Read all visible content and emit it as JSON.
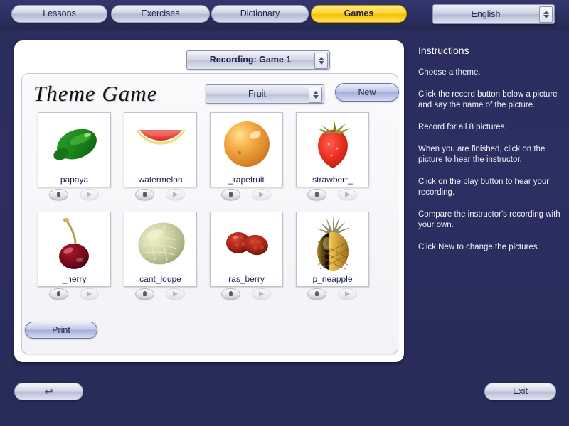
{
  "nav": {
    "tabs": [
      {
        "label": "Lessons",
        "active": false
      },
      {
        "label": "Exercises",
        "active": false
      },
      {
        "label": "Dictionary",
        "active": false
      },
      {
        "label": "Games",
        "active": true
      }
    ],
    "language": "English"
  },
  "panel": {
    "recording_select": "Recording: Game 1",
    "game_title": "Theme Game",
    "theme_select": "Fruit",
    "new_button": "New",
    "print_button": "Print"
  },
  "cards": [
    {
      "label": "papaya",
      "image": "papaya",
      "record_enabled": true,
      "play_enabled": false
    },
    {
      "label": "watermelon",
      "image": "watermelon",
      "record_enabled": true,
      "play_enabled": false
    },
    {
      "label": "_rapefruit",
      "image": "grapefruit",
      "record_enabled": true,
      "play_enabled": false
    },
    {
      "label": "strawberr_",
      "image": "strawberry",
      "record_enabled": true,
      "play_enabled": false
    },
    {
      "label": "_herry",
      "image": "cherry",
      "record_enabled": true,
      "play_enabled": false
    },
    {
      "label": "cant_loupe",
      "image": "cantaloupe",
      "record_enabled": true,
      "play_enabled": false
    },
    {
      "label": "ras_berry",
      "image": "raspberry",
      "record_enabled": true,
      "play_enabled": false
    },
    {
      "label": "p_neapple",
      "image": "pineapple",
      "record_enabled": true,
      "play_enabled": false
    }
  ],
  "instructions": {
    "heading": "Instructions",
    "paragraphs": [
      "Choose a theme.",
      "Click the record button below a picture and say the name of the picture.",
      "Record for all 8 pictures.",
      "When you are finished, click on the picture to hear the instructor.",
      "Click on the play button to hear your recording.",
      "Compare the instructor's recording with your own.",
      "Click New to change the pictures."
    ]
  },
  "footer": {
    "back_icon": "↩",
    "exit_button": "Exit"
  },
  "colors": {
    "background": "#2b2f62",
    "active_tab": "#ffd83a",
    "panel": "#ffffff",
    "text_on_dark": "#ffffff",
    "caption": "#1b2050"
  }
}
